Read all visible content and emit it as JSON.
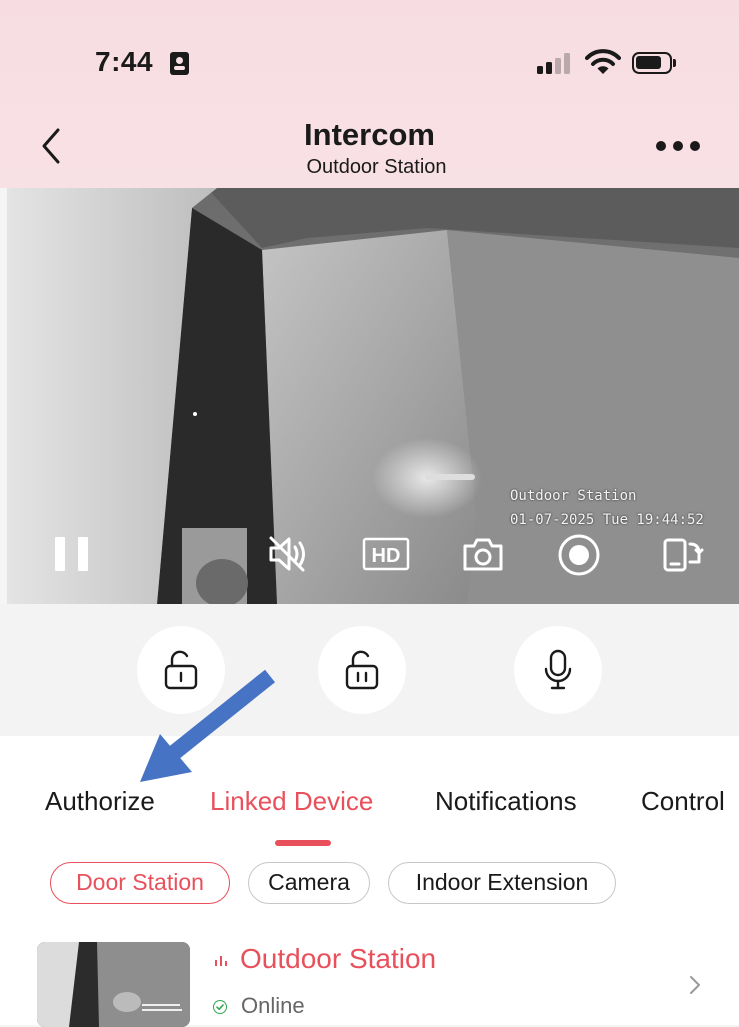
{
  "status_bar": {
    "time": "7:44",
    "badge_icon": "person-badge-icon",
    "signal_icon": "cellular-signal-icon",
    "wifi_icon": "wifi-icon",
    "battery_icon": "battery-icon",
    "battery_level": 0.8
  },
  "header": {
    "title": "Intercom",
    "subtitle": "Outdoor Station",
    "back_icon": "chevron-left-icon",
    "more_icon": "more-horizontal-icon"
  },
  "video": {
    "osd_name": "Outdoor Station",
    "osd_timestamp": "01-07-2025 Tue 19:44:52",
    "controls": [
      "pause-icon",
      "mute-icon",
      "hd-icon",
      "snapshot-icon",
      "record-icon",
      "screen-switch-icon"
    ]
  },
  "actions": {
    "items": [
      "unlock-1-icon",
      "unlock-2-icon",
      "microphone-icon"
    ]
  },
  "tabs": {
    "items": [
      {
        "label": "Authorize"
      },
      {
        "label": "Linked Device",
        "active": true
      },
      {
        "label": "Notifications"
      },
      {
        "label": "Control"
      }
    ]
  },
  "filters": {
    "items": [
      {
        "label": "Door Station",
        "active": true
      },
      {
        "label": "Camera"
      },
      {
        "label": "Indoor Extension"
      }
    ]
  },
  "device": {
    "name": "Outdoor Station",
    "status": "Online",
    "status_icon": "check-circle-icon",
    "chevron_icon": "chevron-right-icon"
  },
  "colors": {
    "accent": "#e8505b",
    "online": "#2fa84f",
    "annotation_arrow": "#4673c4",
    "header_bg": "#f8e0e4"
  }
}
